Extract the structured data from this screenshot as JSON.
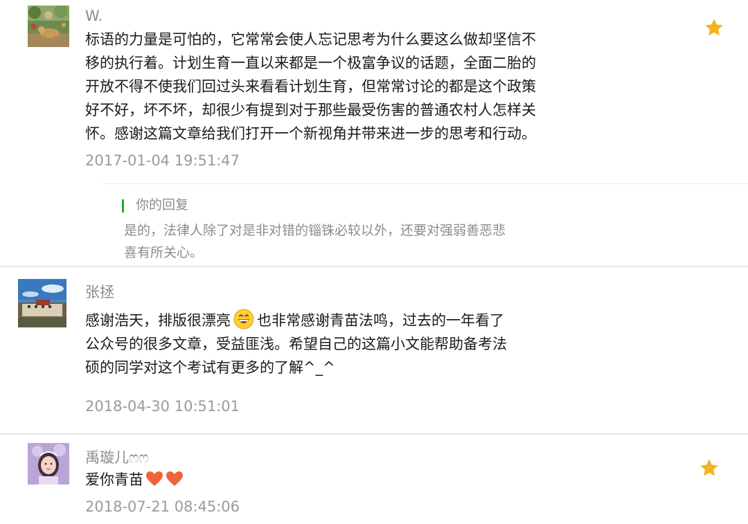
{
  "colors": {
    "star": "#f5b324",
    "reply_bar": "#1aad19",
    "heart": "#f2633a",
    "divider": "#e6e6e6"
  },
  "comments": [
    {
      "username": "W.",
      "content_lines": [
        "标语的力量是可怕的，它常常会使人忘记思考为什么要这么做却坚信不",
        "移的执行着。计划生育一直以来都是一个极富争议的话题，全面二胎的",
        "开放不得不使我们回过头来看看计划生育，但常常讨论的都是这个政策",
        "好不好，坏不坏，却很少有提到对于那些最受伤害的普通农村人怎样关",
        "怀。感谢这篇文章给我们打开一个新视角并带来进一步的思考和行动。"
      ],
      "timestamp": "2017-01-04 19:51:47",
      "starred": true,
      "star_icon": "star-icon",
      "reply": {
        "title": "你的回复",
        "text_lines": [
          "是的，法律人除了对是非对错的锱铢必较以外，还要对强弱善恶悲",
          "喜有所关心。"
        ]
      }
    },
    {
      "username": "张拯",
      "content_line1_before": "感谢浩天，排版很漂亮",
      "emoji_icon": "grinning-face-emoji",
      "content_line1_after": "也非常感谢青苗法鸣，过去的一年看了",
      "content_lines_rest": [
        "公众号的很多文章，受益匪浅。希望自己的这篇小文能帮助备考法",
        "硕的同学对这个考试有更多的了解^_^"
      ],
      "timestamp": "2018-04-30 10:51:01",
      "starred": false
    },
    {
      "username": "禹璇儿ෆෆ",
      "content": "爱你青苗",
      "heart_icon": "heart-icon",
      "heart_count": 2,
      "timestamp": "2018-07-21 08:45:06",
      "starred": true,
      "star_icon": "star-icon"
    }
  ]
}
